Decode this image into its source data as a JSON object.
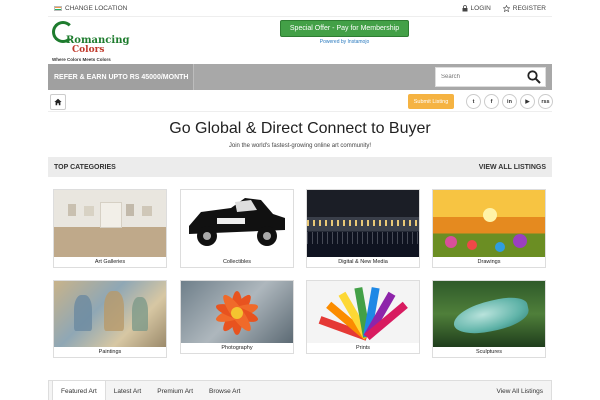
{
  "topbar": {
    "location_label": "CHANGE LOCATION",
    "login_label": "LOGIN",
    "register_label": "REGISTER"
  },
  "logo": {
    "line1": "Romancing",
    "line2": "Colors",
    "tagline": "Where Colors Meets Colors"
  },
  "offer": {
    "label": "Special Offer - Pay for Membership",
    "powered": "Powered by Instamojo"
  },
  "banner": {
    "refer": "REFER & EARN UPTO RS 45000/MONTH",
    "search_placeholder": "Search"
  },
  "nav": {
    "submit_label": "Submit Listing",
    "social": [
      "t",
      "f",
      "in",
      "▶",
      "rss"
    ]
  },
  "hero": {
    "title": "Go Global & Direct Connect to Buyer",
    "subtitle": "Join the world's fastest-growing online art community!"
  },
  "categories": {
    "heading": "TOP CATEGORIES",
    "view_all": "VIEW ALL LISTINGS",
    "items": [
      {
        "label": "Art Galleries"
      },
      {
        "label": "Collectibles"
      },
      {
        "label": "Digital & New Media"
      },
      {
        "label": "Drawings"
      },
      {
        "label": "Paintings"
      },
      {
        "label": "Photography"
      },
      {
        "label": "Prints"
      },
      {
        "label": "Sculptures"
      }
    ]
  },
  "tabs": {
    "items": [
      "Featured Art",
      "Latest Art",
      "Premium Art",
      "Browse Art"
    ],
    "view_all": "View All Listings"
  },
  "colors": {
    "offer_green": "#43a047",
    "banner_gray": "#a8a8a8",
    "submit_orange": "#f5b342"
  }
}
